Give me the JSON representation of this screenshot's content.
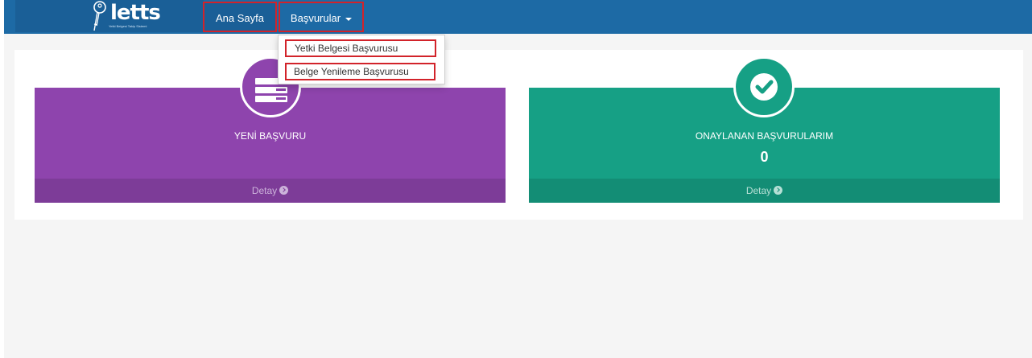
{
  "brand": {
    "logo_text": "letts",
    "logo_subtitle": "Yetki Belgesi Takip Sistemi",
    "icon": "key-icon"
  },
  "nav": {
    "home_label": "Ana Sayfa",
    "applications_label": "Başvurular"
  },
  "dropdown": {
    "items": [
      {
        "label": "Yetki Belgesi Başvurusu"
      },
      {
        "label": "Belge Yenileme Başvurusu"
      }
    ]
  },
  "cards": [
    {
      "title": "YENİ BAŞVURU",
      "value": "",
      "footer": "Detay",
      "icon": "server-icon",
      "color": "#8e44ad"
    },
    {
      "title": "ONAYLANAN BAŞVURULARIM",
      "value": "0",
      "footer": "Detay",
      "icon": "check-icon",
      "color": "#16a085"
    }
  ],
  "colors": {
    "navbar": "#1d6aa5",
    "highlight": "#d2232a",
    "background": "#f5f5f5"
  }
}
